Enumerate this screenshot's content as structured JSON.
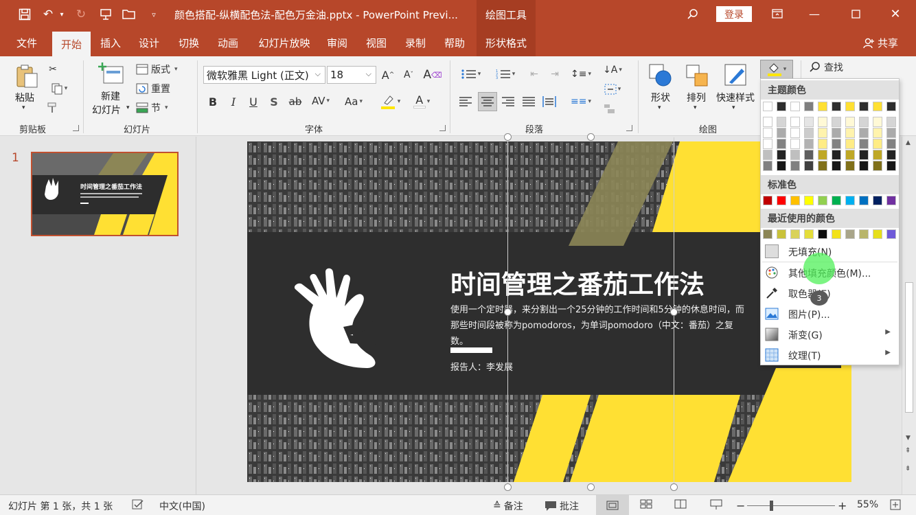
{
  "window": {
    "title": "颜色搭配-纵横配色法-配色万金油.pptx - PowerPoint Previ...",
    "contextual_tab_group": "绘图工具",
    "login": "登录",
    "share": "共享"
  },
  "menu": [
    "文件",
    "开始",
    "插入",
    "设计",
    "切换",
    "动画",
    "幻灯片放映",
    "审阅",
    "视图",
    "录制",
    "帮助",
    "形状格式"
  ],
  "ribbon": {
    "groups": {
      "clipboard": "剪贴板",
      "slides": "幻灯片",
      "font": "字体",
      "paragraph": "段落",
      "drawing": "绘图"
    },
    "paste": "粘贴",
    "new_slide_1": "新建",
    "new_slide_2": "幻灯片",
    "layout": "版式",
    "reset": "重置",
    "section": "节",
    "font_name": "微软雅黑 Light (正文)",
    "font_size": "18",
    "shape": "形状",
    "arrange": "排列",
    "quick_styles": "快速样式",
    "find": "查找"
  },
  "slide": {
    "number": "1",
    "title": "时间管理之番茄工作法",
    "body": "使用一个定时器，来分割出一个25分钟的工作时间和5分钟的休息时间，而那些时间段被称为pomodoros，为单词pomodoro（中文：番茄）之复数。",
    "reporter": "报告人：李发展"
  },
  "fill_menu": {
    "theme_colors_label": "主题颜色",
    "standard_colors_label": "标准色",
    "recent_colors_label": "最近使用的颜色",
    "theme_row": [
      "#ffffff",
      "#2e2e2e",
      "#ffffff",
      "#7f7f7f",
      "#ffe033",
      "#2e2e2e",
      "#ffe033",
      "#2e2e2e",
      "#ffe033",
      "#2e2e2e"
    ],
    "standard": [
      "#c00000",
      "#ff0000",
      "#ffc000",
      "#ffff00",
      "#92d050",
      "#00b050",
      "#00b0f0",
      "#0070c0",
      "#002060",
      "#7030a0"
    ],
    "recent": [
      "#8c8656",
      "#c9c23a",
      "#d9d25a",
      "#e4dd3a",
      "#0d0d0d",
      "#f2e21a",
      "#a9a58a",
      "#b8b56a",
      "#e6df1a",
      "#6f5ad9"
    ],
    "items": [
      {
        "label": "无填充(N)"
      },
      {
        "label": "其他填充颜色(M)..."
      },
      {
        "label": "取色器(E)"
      },
      {
        "label": "图片(P)..."
      },
      {
        "label": "渐变(G)"
      },
      {
        "label": "纹理(T)"
      }
    ],
    "click_badge": "3"
  },
  "status": {
    "slide_count": "幻灯片 第 1 张，共 1 张",
    "language": "中文(中国)",
    "notes": "备注",
    "comments": "批注",
    "zoom": "55%"
  },
  "colors": {
    "accent": "#b7472a",
    "slide_yellow": "#ffe033",
    "slide_dark": "#2e2e2e"
  }
}
